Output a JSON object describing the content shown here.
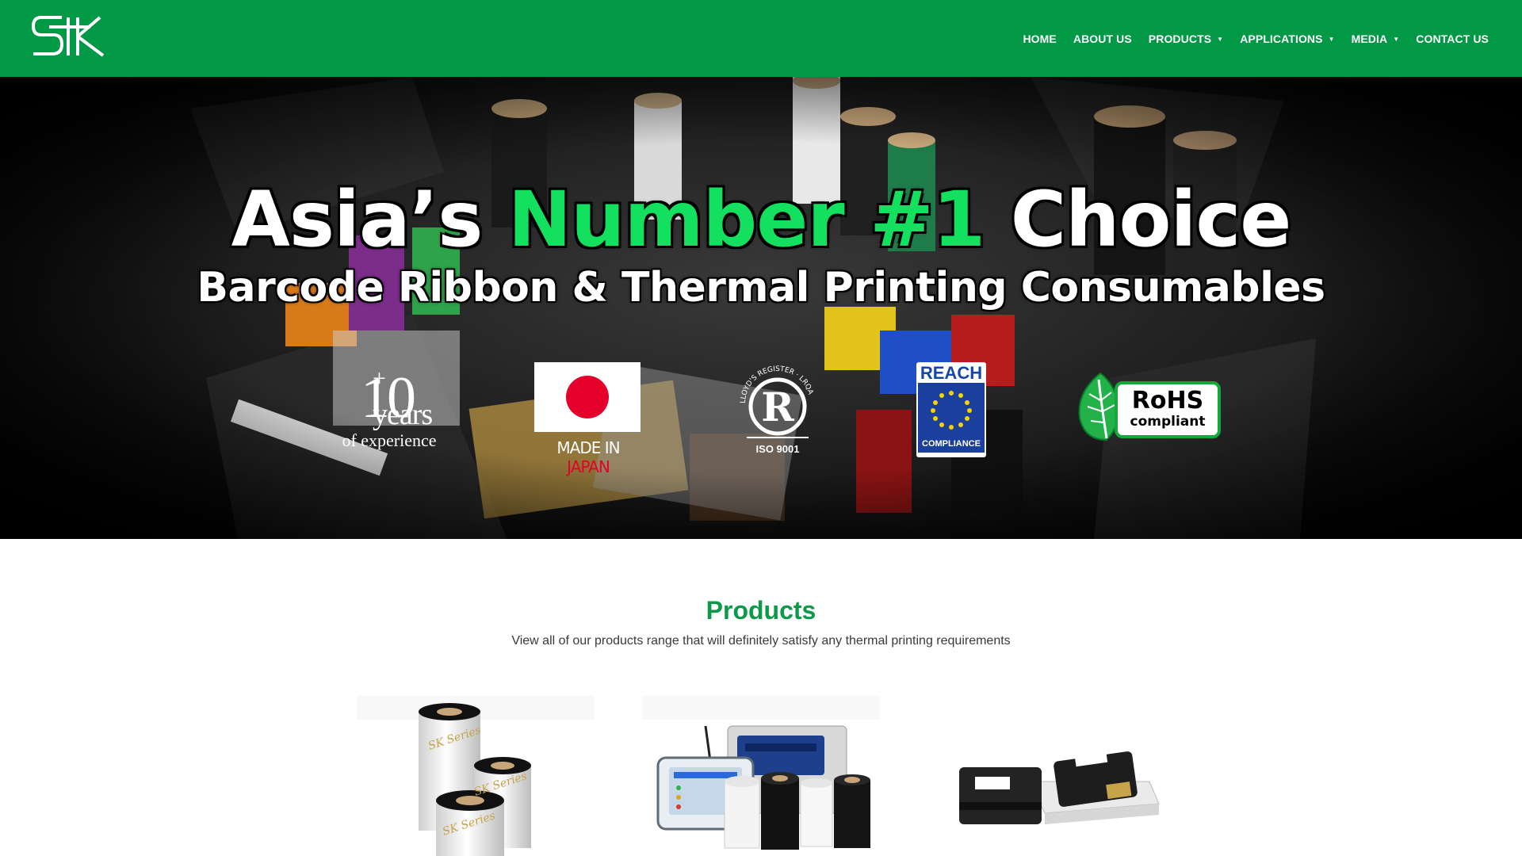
{
  "header": {
    "logo_icon": "sk-logo-icon",
    "nav": [
      {
        "label": "HOME",
        "has_dropdown": false
      },
      {
        "label": "ABOUT US",
        "has_dropdown": false
      },
      {
        "label": "PRODUCTS",
        "has_dropdown": true
      },
      {
        "label": "APPLICATIONS",
        "has_dropdown": true
      },
      {
        "label": "MEDIA",
        "has_dropdown": true
      },
      {
        "label": "CONTACT US",
        "has_dropdown": false
      }
    ],
    "caret_glyph": "▼"
  },
  "hero": {
    "headline_pre": "Asia’s ",
    "headline_accent": "Number #1",
    "headline_post": " Choice",
    "subline": "Barcode Ribbon & Thermal Printing Consumables",
    "badges": {
      "years_number": "10",
      "years_plus": "+",
      "years_word": "years",
      "years_caption": "of experience",
      "made_in": "MADE IN ",
      "made_in_country": "JAPAN",
      "iso_label": "ISO 9001",
      "iso_arc": "LLOYD'S REGISTER · LRQA",
      "iso_mark": "R",
      "reach_title": "REACH",
      "reach_footer": "COMPLIANCE",
      "rohs_title": "RoHS",
      "rohs_sub": "compliant"
    }
  },
  "products": {
    "title": "Products",
    "subtitle": "View all of our products range that will definitely satisfy any thermal printing requirements",
    "items": [
      {
        "icon": "ribbon-rolls-image",
        "roll_label": "SK Series"
      },
      {
        "icon": "thermal-printer-image",
        "roll_label": ""
      },
      {
        "icon": "inkjet-cartridge-image",
        "roll_label": ""
      }
    ]
  },
  "colors": {
    "brand_green": "#019846",
    "accent_green": "#14e060",
    "title_green": "#0b9a48"
  }
}
